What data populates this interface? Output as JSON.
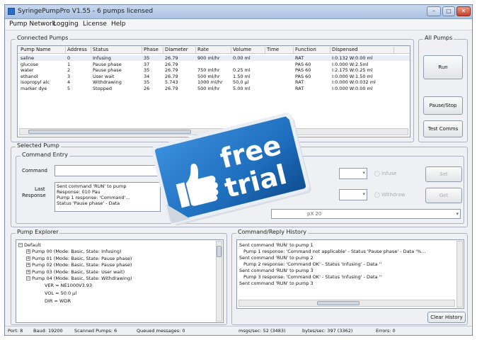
{
  "window": {
    "title": "SyringePumpPro V1.55 - 6 pumps licensed",
    "controls": [
      "minimize",
      "maximize",
      "close"
    ]
  },
  "menu": [
    "Pump Network",
    "Logging",
    "License",
    "Help"
  ],
  "connected_pumps": {
    "label": "Connected Pumps",
    "columns": [
      "Pump Name",
      "Address",
      "Status",
      "Phase",
      "Diameter",
      "Rate",
      "Volume",
      "Time",
      "Function",
      "Dispensed"
    ],
    "rows": [
      [
        "saline",
        "0",
        "Infusing",
        "35",
        "26.79",
        "900 ml/hr",
        "0.00 ml",
        "",
        "RAT",
        "I:0.132 W:0.00 ml"
      ],
      [
        "glucose",
        "1",
        "Pause phase",
        "37",
        "26.79",
        "",
        "",
        "",
        "PAS 60",
        "I:0.000 W:2.5ml"
      ],
      [
        "water",
        "2",
        "Pause phase",
        "35",
        "26.79",
        "750 ml/hr",
        "0.25 ml",
        "",
        "PAS 60",
        "I:2.175 W:0.25 ml"
      ],
      [
        "ethanol",
        "3",
        "User wait",
        "34",
        "26.79",
        "500 ml/hr",
        "1.50 ml",
        "",
        "PAS 60",
        "I:0.000 W:1.50 ml"
      ],
      [
        "isopropyl alc",
        "4",
        "Withdrawing",
        "35",
        "5.743",
        "1000 ml/hr",
        "50.0 µl",
        "",
        "RAT",
        "I:0.000 W:0.032 ml"
      ],
      [
        "marker dye",
        "5",
        "Stopped",
        "26",
        "26.79",
        "500 ml/hr",
        "5.00 ml",
        "",
        "RAT",
        "I:0.000 W:0.00 ml"
      ]
    ]
  },
  "all_pumps": {
    "label": "All Pumps",
    "buttons": [
      "Run",
      "Pause/Stop",
      "Test Comms"
    ]
  },
  "selected_pump": {
    "label": "Selected Pump",
    "command_entry_label": "Command Entry",
    "command_label": "Command",
    "last_response_label": "Last Response",
    "last_response_lines": [
      "Sent command 'RUN' to pump",
      "Response: 010 Pau",
      "Pump 1 response: 'Command'...",
      "Status 'Pause phase' - Data"
    ],
    "set_button": "Set",
    "get_button": "Get",
    "radio_infuse": "Infuse",
    "radio_withdraw": "Withdraw",
    "path_field": "pX 20"
  },
  "pump_explorer": {
    "label": "Pump Explorer",
    "root": "Default",
    "items": [
      "Pump 00 (Mode: Basic, State: Infusing)",
      "Pump 01 (Mode: Basic, State: Pause phase)",
      "Pump 02 (Mode: Basic, State: Pause phase)",
      "Pump 03 (Mode: Basic, State: User wait)",
      "Pump 04 (Mode: Basic, State: Withdrawing)"
    ],
    "children": [
      "VER = NE1000V3.93",
      "VOL = 50.0 µl",
      "DIR = WDR"
    ]
  },
  "history": {
    "label": "Command/Reply History",
    "lines": [
      "Sent command 'RUN' to pump 1",
      "Pump 1 response: 'Command not applicable' - Status 'Pause phase' - Data '%...",
      "Sent command 'RUN' to pump 2",
      "Pump 2 response: 'Command OK' - Status 'Infusing' - Data ''",
      "Sent command 'RUN' to pump 3",
      "Pump 3 response: 'Command OK' - Status 'Infusing' - Data ''",
      "Sent command 'RUN' to pump 3"
    ],
    "clear_button": "Clear History"
  },
  "status_bar": {
    "port": "Port: 8",
    "baud": "Baud: 19200",
    "scanned": "Scanned Pumps: 6",
    "queued": "Queued messages: 0",
    "msgs": "msgs/sec: 52 (3483)",
    "bytes": "bytes/sec: 397 (3362)",
    "errors": "Errors: 0"
  },
  "promo_sticker": {
    "text_line1": "free",
    "text_line2": "trial",
    "icon": "thumbs-up-icon",
    "color": "#1f6fbf"
  }
}
